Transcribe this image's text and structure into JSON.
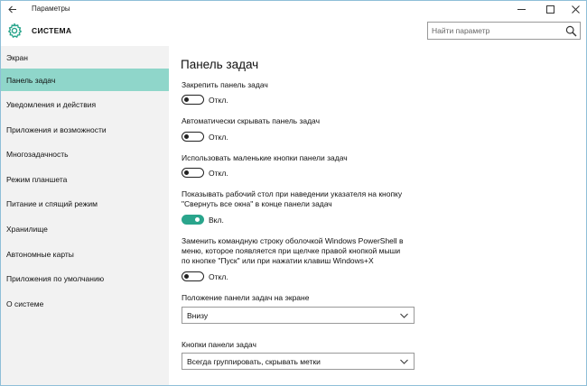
{
  "window": {
    "title": "Параметры"
  },
  "header": {
    "section": "СИСТЕМА",
    "search_placeholder": "Найти параметр"
  },
  "sidebar": {
    "items": [
      {
        "label": "Экран"
      },
      {
        "label": "Панель задач",
        "active": true
      },
      {
        "label": "Уведомления и действия"
      },
      {
        "label": "Приложения и возможности"
      },
      {
        "label": "Многозадачность"
      },
      {
        "label": "Режим планшета"
      },
      {
        "label": "Питание и спящий режим"
      },
      {
        "label": "Хранилище"
      },
      {
        "label": "Автономные карты"
      },
      {
        "label": "Приложения по умолчанию"
      },
      {
        "label": "О системе"
      }
    ]
  },
  "main": {
    "title": "Панель задач",
    "settings": [
      {
        "label": "Закрепить панель задач",
        "state": "Откл.",
        "on": false
      },
      {
        "label": "Автоматически скрывать панель задач",
        "state": "Откл.",
        "on": false
      },
      {
        "label": "Использовать маленькие кнопки панели задач",
        "state": "Откл.",
        "on": false
      },
      {
        "label_lines": [
          "Показывать рабочий стол при наведении указателя на кнопку",
          "\"Свернуть все окна\" в конце панели задач"
        ],
        "state": "Вкл.",
        "on": true
      },
      {
        "label_lines": [
          "Заменить командную строку оболочкой Windows PowerShell в",
          "меню, которое появляется при щелчке правой кнопкой мыши",
          "по кнопке \"Пуск\" или при нажатии клавиш Windows+X"
        ],
        "state": "Откл.",
        "on": false
      }
    ],
    "position": {
      "label": "Положение панели задач на экране",
      "value": "Внизу"
    },
    "buttons": {
      "label": "Кнопки панели задач",
      "value": "Всегда группировать, скрывать метки"
    }
  },
  "colors": {
    "accent": "#2aa58c",
    "sidebar_active": "#8fd6ca"
  }
}
